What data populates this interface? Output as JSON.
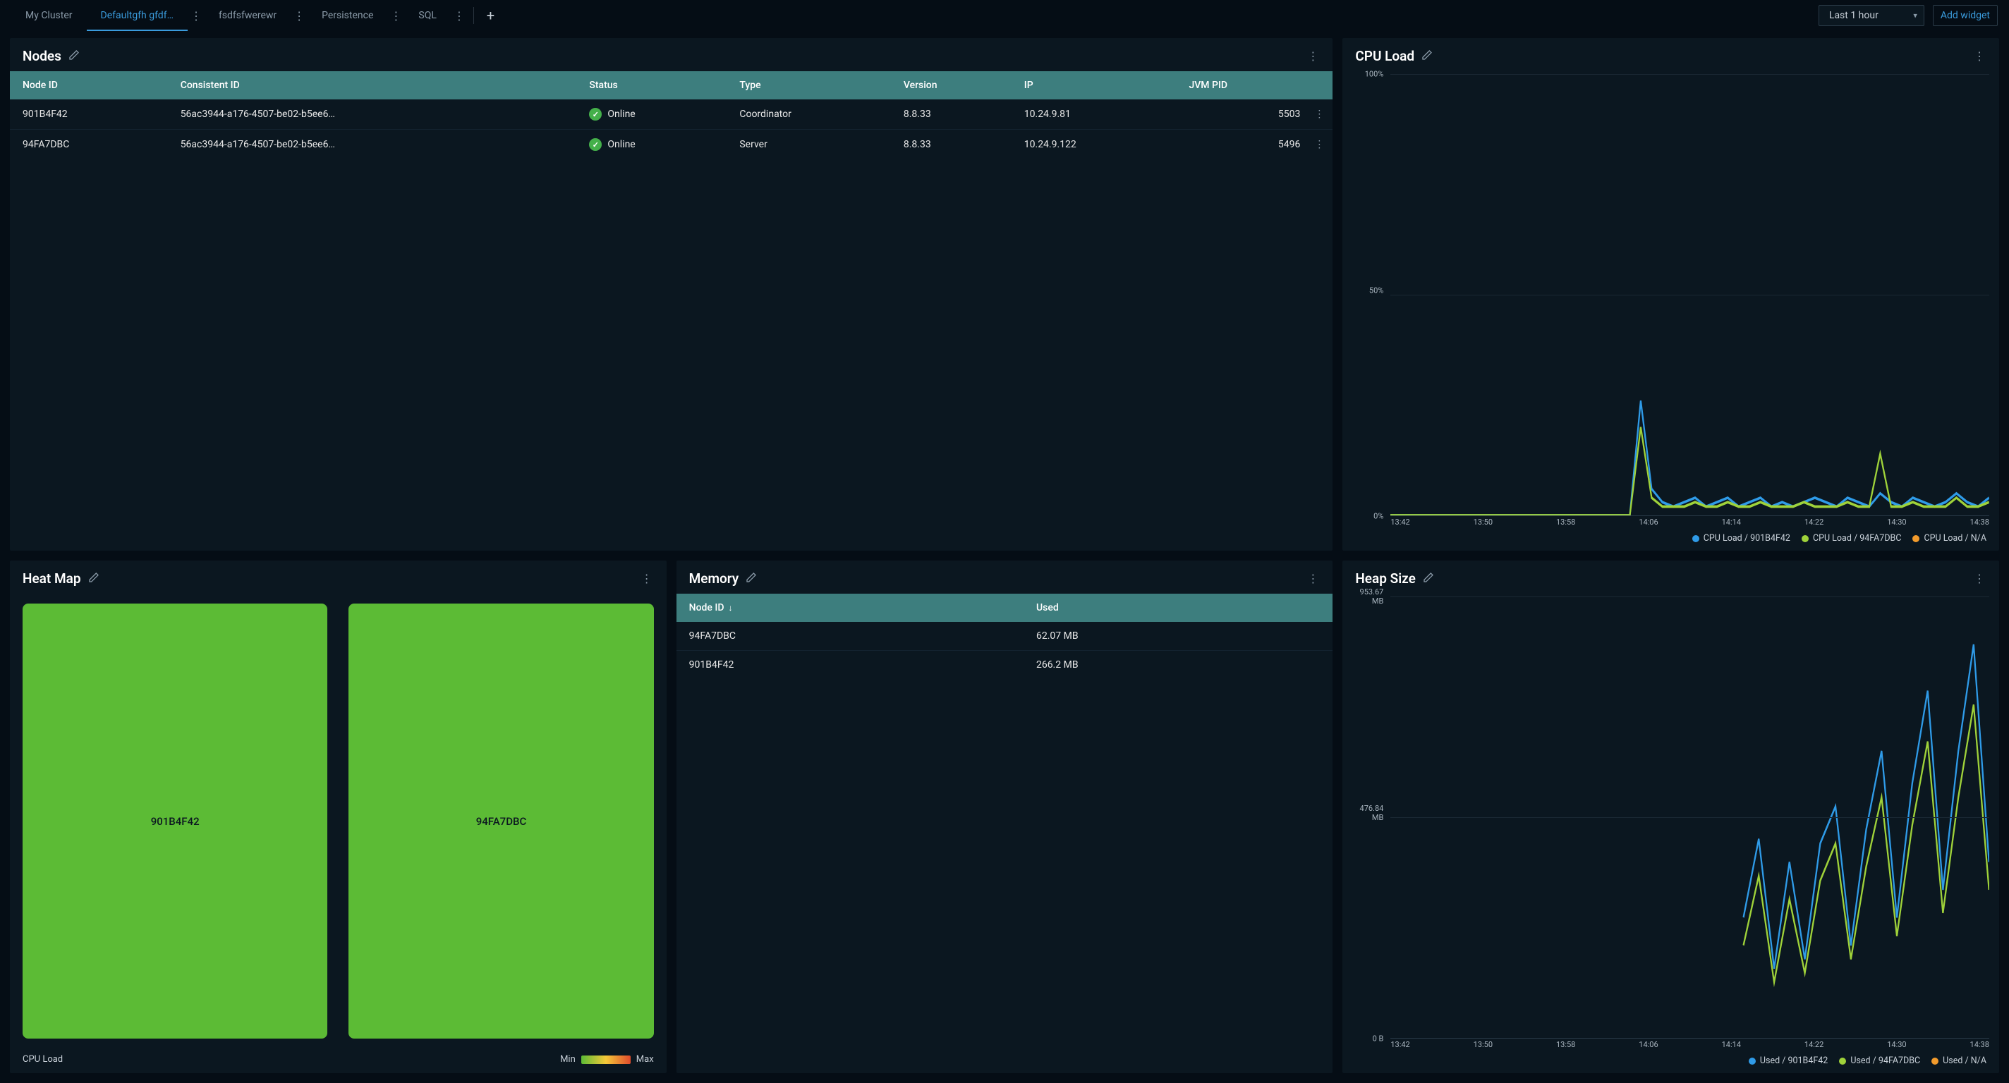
{
  "tabs": [
    {
      "label": "My Cluster",
      "active": false,
      "more": false
    },
    {
      "label": "Defaultgfh gfdf…",
      "active": true,
      "more": true
    },
    {
      "label": "fsdfsfwerewr",
      "active": false,
      "more": true
    },
    {
      "label": "Persistence",
      "active": false,
      "more": true
    },
    {
      "label": "SQL",
      "active": false,
      "more": true
    }
  ],
  "range_select": "Last 1 hour",
  "add_widget": "Add widget",
  "panels": {
    "nodes": {
      "title": "Nodes",
      "columns": [
        "Node ID",
        "Consistent ID",
        "Status",
        "Type",
        "Version",
        "IP",
        "JVM PID"
      ],
      "rows": [
        {
          "node_id": "901B4F42",
          "consistent": "56ac3944-a176-4507-be02-b5ee6…",
          "status": "Online",
          "type": "Coordinator",
          "version": "8.8.33",
          "ip": "10.24.9.81",
          "jvm": "5503"
        },
        {
          "node_id": "94FA7DBC",
          "consistent": "56ac3944-a176-4507-be02-b5ee6…",
          "status": "Online",
          "type": "Server",
          "version": "8.8.33",
          "ip": "10.24.9.122",
          "jvm": "5496"
        }
      ]
    },
    "cpu": {
      "title": "CPU Load",
      "y_ticks": [
        "100%",
        "50%",
        "0%"
      ],
      "x_ticks": [
        "13:42",
        "13:50",
        "13:58",
        "14:06",
        "14:14",
        "14:22",
        "14:30",
        "14:38"
      ],
      "legend": [
        {
          "label": "CPU Load / 901B4F42",
          "color": "#2f9be8"
        },
        {
          "label": "CPU Load / 94FA7DBC",
          "color": "#9fd23a"
        },
        {
          "label": "CPU Load / N/A",
          "color": "#f29b2c"
        }
      ]
    },
    "heatmap": {
      "title": "Heat Map",
      "tiles": [
        "901B4F42",
        "94FA7DBC"
      ],
      "metric": "CPU Load",
      "min": "Min",
      "max": "Max"
    },
    "memory": {
      "title": "Memory",
      "columns": [
        "Node ID",
        "Used"
      ],
      "rows": [
        {
          "node_id": "94FA7DBC",
          "used": "62.07 MB"
        },
        {
          "node_id": "901B4F42",
          "used": "266.2 MB"
        }
      ]
    },
    "heap": {
      "title": "Heap Size",
      "y_ticks": [
        "953.67 MB",
        "476.84 MB",
        "0 B"
      ],
      "x_ticks": [
        "13:42",
        "13:50",
        "13:58",
        "14:06",
        "14:14",
        "14:22",
        "14:30",
        "14:38"
      ],
      "legend": [
        {
          "label": "Used / 901B4F42",
          "color": "#2f9be8"
        },
        {
          "label": "Used / 94FA7DBC",
          "color": "#9fd23a"
        },
        {
          "label": "Used / N/A",
          "color": "#f29b2c"
        }
      ]
    }
  },
  "chart_data": [
    {
      "type": "line",
      "title": "CPU Load",
      "xlabel": "",
      "ylabel": "CPU Load",
      "ylim": [
        0,
        100
      ],
      "x_ticks": [
        "13:42",
        "13:50",
        "13:58",
        "14:06",
        "14:14",
        "14:22",
        "14:30",
        "14:38"
      ],
      "series": [
        {
          "name": "CPU Load / 901B4F42",
          "color": "#2f9be8",
          "values_pct": [
            0,
            0,
            0,
            0,
            0,
            0,
            0,
            0,
            0,
            0,
            0,
            0,
            0,
            0,
            0,
            0,
            0,
            0,
            0,
            0,
            0,
            0,
            0,
            26,
            6,
            3,
            2,
            3,
            4,
            2,
            3,
            4,
            2,
            3,
            4,
            2,
            3,
            2,
            3,
            4,
            3,
            2,
            4,
            3,
            2,
            5,
            3,
            2,
            4,
            3,
            2,
            3,
            5,
            3,
            2,
            4
          ]
        },
        {
          "name": "CPU Load / 94FA7DBC",
          "color": "#9fd23a",
          "values_pct": [
            0,
            0,
            0,
            0,
            0,
            0,
            0,
            0,
            0,
            0,
            0,
            0,
            0,
            0,
            0,
            0,
            0,
            0,
            0,
            0,
            0,
            0,
            0,
            20,
            4,
            2,
            2,
            2,
            3,
            2,
            2,
            3,
            2,
            2,
            3,
            2,
            2,
            2,
            3,
            2,
            2,
            2,
            3,
            2,
            2,
            14,
            2,
            2,
            3,
            2,
            2,
            2,
            4,
            2,
            2,
            3
          ]
        },
        {
          "name": "CPU Load / N/A",
          "color": "#f29b2c",
          "values_pct": []
        }
      ]
    },
    {
      "type": "line",
      "title": "Heap Size",
      "xlabel": "",
      "ylabel": "Used",
      "ylim_mb": [
        0,
        953.67
      ],
      "x_ticks": [
        "13:42",
        "13:50",
        "13:58",
        "14:06",
        "14:14",
        "14:22",
        "14:30",
        "14:38"
      ],
      "series": [
        {
          "name": "Used / 901B4F42",
          "color": "#2f9be8",
          "values_mb": [
            null,
            null,
            null,
            null,
            null,
            null,
            null,
            null,
            null,
            null,
            null,
            null,
            null,
            null,
            null,
            null,
            null,
            null,
            null,
            null,
            null,
            null,
            null,
            260,
            430,
            150,
            380,
            170,
            420,
            500,
            200,
            450,
            620,
            260,
            550,
            750,
            320,
            620,
            850,
            380
          ]
        },
        {
          "name": "Used / 94FA7DBC",
          "color": "#9fd23a",
          "values_mb": [
            null,
            null,
            null,
            null,
            null,
            null,
            null,
            null,
            null,
            null,
            null,
            null,
            null,
            null,
            null,
            null,
            null,
            null,
            null,
            null,
            null,
            null,
            null,
            200,
            350,
            120,
            300,
            140,
            340,
            420,
            170,
            370,
            520,
            220,
            460,
            640,
            270,
            520,
            720,
            320
          ]
        },
        {
          "name": "Used / N/A",
          "color": "#f29b2c",
          "values_mb": []
        }
      ]
    },
    {
      "type": "heatmap",
      "title": "Heat Map",
      "metric": "CPU Load",
      "cells": [
        {
          "label": "901B4F42",
          "value": "low",
          "color": "#5cbb35"
        },
        {
          "label": "94FA7DBC",
          "value": "low",
          "color": "#5cbb35"
        }
      ]
    },
    {
      "type": "table",
      "title": "Memory",
      "columns": [
        "Node ID",
        "Used"
      ],
      "rows": [
        [
          "94FA7DBC",
          "62.07 MB"
        ],
        [
          "901B4F42",
          "266.2 MB"
        ]
      ]
    }
  ]
}
